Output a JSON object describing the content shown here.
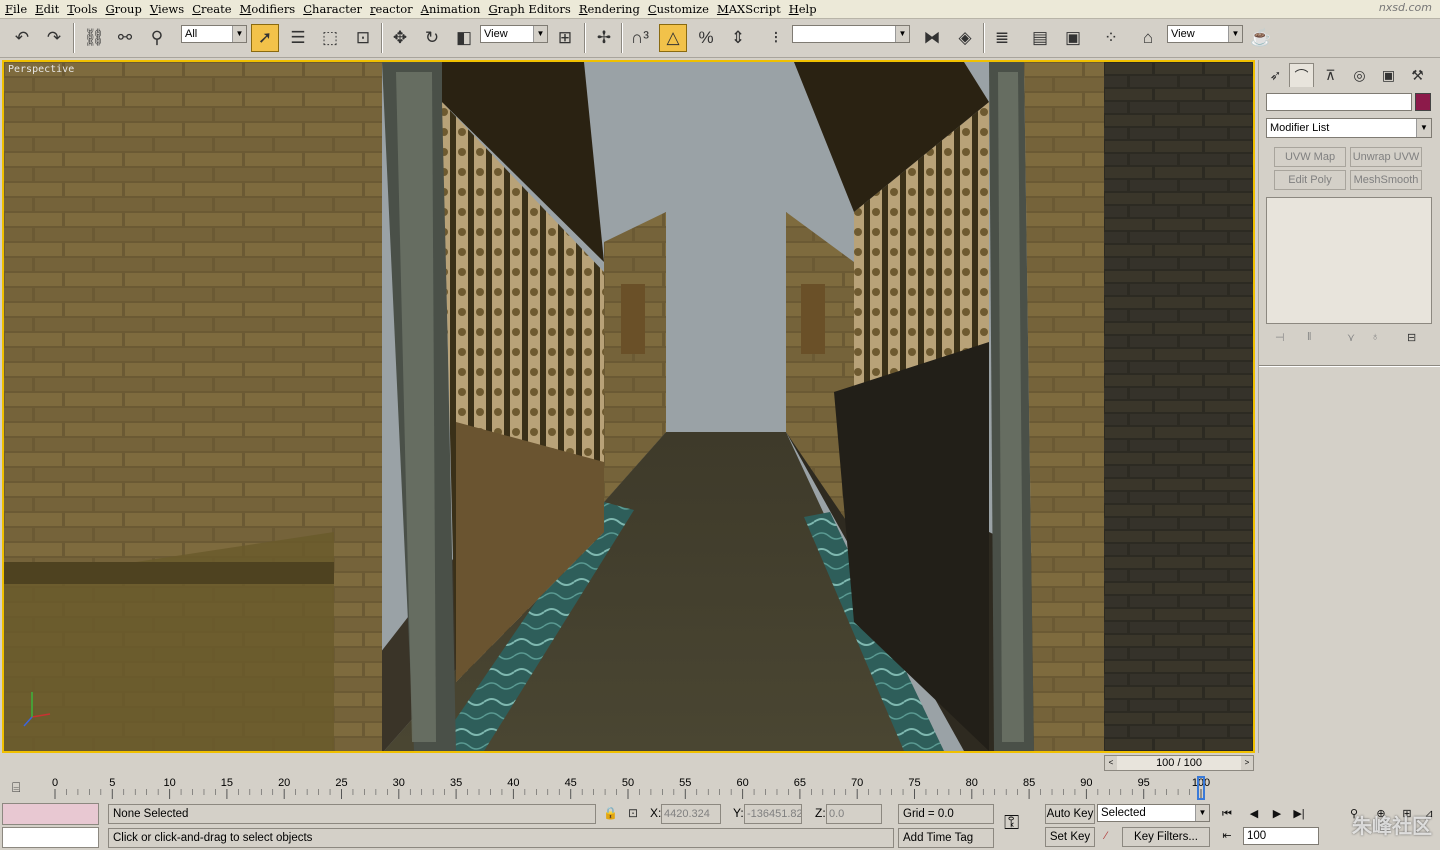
{
  "menu": [
    "File",
    "Edit",
    "Tools",
    "Group",
    "Views",
    "Create",
    "Modifiers",
    "Character",
    "reactor",
    "Animation",
    "Graph Editors",
    "Rendering",
    "Customize",
    "MAXScript",
    "Help"
  ],
  "watermark_top": "nxsd.com",
  "toolbar": {
    "selection_filter": "All",
    "ref_coord_1": "View",
    "named_selection": "",
    "ref_coord_2": "View",
    "icons": [
      "undo-icon",
      "redo-icon",
      "select-link-icon",
      "unlink-icon",
      "bind-spacewarp-icon",
      "select-object-icon",
      "select-by-name-icon",
      "rect-region-icon",
      "window-crossing-icon",
      "move-icon",
      "rotate-icon",
      "scale-icon",
      "pivot-center-icon",
      "manipulate-icon",
      "snap-3-icon",
      "angle-snap-icon",
      "percent-snap-icon",
      "spinner-snap-icon",
      "edit-named-sel-icon",
      "mirror-icon",
      "align-icon",
      "layer-manager-icon",
      "curve-editor-icon",
      "schematic-view-icon",
      "material-editor-icon",
      "render-scene-icon",
      "quick-render-icon"
    ]
  },
  "viewport": {
    "label": "Perspective",
    "axes": [
      "x",
      "y",
      "z"
    ]
  },
  "command_panel": {
    "tabs": [
      "create-tab",
      "modify-tab",
      "hierarchy-tab",
      "motion-tab",
      "display-tab",
      "utilities-tab"
    ],
    "object_name": "",
    "object_color": "#8c1a4a",
    "modifier_list": "Modifier List",
    "modifier_buttons": [
      "UVW Map",
      "Unwrap UVW",
      "Edit Poly",
      "MeshSmooth"
    ]
  },
  "timeline": {
    "slider_label": "100 / 100",
    "current": 100,
    "total": 100,
    "ticks": [
      0,
      5,
      10,
      15,
      20,
      25,
      30,
      35,
      40,
      45,
      50,
      55,
      60,
      65,
      70,
      75,
      80,
      85,
      90,
      95,
      100
    ]
  },
  "status": {
    "selection": "None Selected",
    "prompt": "Click or click-and-drag to select objects",
    "x_label": "X:",
    "x_value": "4420.324",
    "y_label": "Y:",
    "y_value": "-136451.82",
    "z_label": "Z:",
    "z_value": "0.0",
    "grid": "Grid = 0.0",
    "add_time_tag": "Add Time Tag",
    "auto_key": "Auto Key",
    "set_key": "Set Key",
    "key_mode": "Selected",
    "key_filters": "Key Filters...",
    "frame": "100"
  },
  "watermark_br": "朱峰社区"
}
